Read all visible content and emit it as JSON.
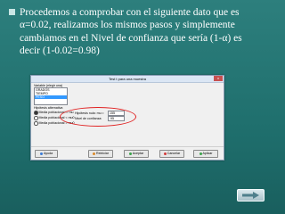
{
  "slide": {
    "bullet_lines": [
      "Procedemos a comprobar con  el siguiente dato que es",
      "α=0.02, realizamos los mismos pasos y simplemente",
      "cambiamos en el Nivel de confianza que sería (1-α) es",
      "decir (1-0.02=0.98)"
    ]
  },
  "dialog": {
    "title": "Test t para una muestra",
    "close_glyph": "x",
    "variable_label": "Variable (elegir una)",
    "variables": [
      "GRADOS",
      "TIEMPO",
      "PESO"
    ],
    "selected_variable": "PESO",
    "hypothesis_label": "Hipótesis alternativa",
    "options": [
      "Media poblacional != mu",
      "Media poblacional < mu0",
      "Media poblacional > mu0"
    ],
    "null_hyp_label": "Hipótesis nula: mu =",
    "null_hyp_value": "155",
    "confidence_label": "Nivel de confianza:",
    "confidence_value": ".95",
    "buttons": {
      "help": "Ayuda",
      "reset": "Reiniciar",
      "accept": "Aceptar",
      "cancel": "Cancelar",
      "apply": "Aplicar"
    }
  },
  "nav": {
    "next_icon": "right-arrow-icon"
  },
  "colors": {
    "background": "#1f6f6d",
    "highlight": "#e02020",
    "selection": "#3399ff"
  }
}
